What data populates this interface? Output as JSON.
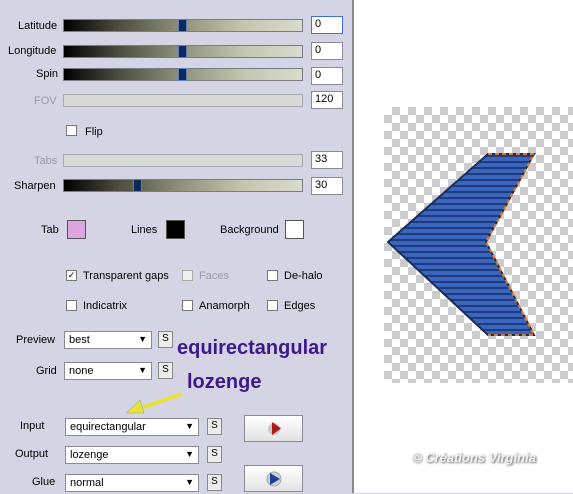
{
  "sliders": [
    {
      "label": "Latitude",
      "value": "0",
      "level": 0.5,
      "enabled": true,
      "focused": true
    },
    {
      "label": "Longitude",
      "value": "0",
      "level": 0.5,
      "enabled": true
    },
    {
      "label": "Spin",
      "value": "0",
      "level": 0.5,
      "enabled": true
    },
    {
      "label": "FOV",
      "value": "120",
      "enabled": false
    },
    {
      "label": "Tabs",
      "value": "33",
      "enabled": false
    },
    {
      "label": "Sharpen",
      "value": "30",
      "level": 0.3,
      "enabled": true
    }
  ],
  "flip": {
    "label": "Flip",
    "checked": false
  },
  "colors": {
    "tab": {
      "label": "Tab",
      "color": "#d9a6e0"
    },
    "lines": {
      "label": "Lines",
      "color": "#000000"
    },
    "background": {
      "label": "Background",
      "color": "#ffffff"
    }
  },
  "checkboxes": {
    "transparent_gaps": {
      "label": "Transparent gaps",
      "checked": true
    },
    "faces": {
      "label": "Faces",
      "checked": false,
      "enabled": false
    },
    "de_halo": {
      "label": "De-halo",
      "checked": false
    },
    "indicatrix": {
      "label": "Indicatrix",
      "checked": false
    },
    "anamorph": {
      "label": "Anamorph",
      "checked": false
    },
    "edges": {
      "label": "Edges",
      "checked": false
    }
  },
  "selects": {
    "preview": {
      "label": "Preview",
      "value": "best"
    },
    "grid": {
      "label": "Grid",
      "value": "none"
    },
    "input": {
      "label": "Input",
      "value": "equirectangular"
    },
    "output": {
      "label": "Output",
      "value": "lozenge"
    },
    "glue": {
      "label": "Glue",
      "value": "normal"
    }
  },
  "s_button_label": "S",
  "annotations": {
    "line1": "equirectangular",
    "line2": "lozenge"
  },
  "watermark": "© Créations Virginia",
  "colors_ui": {
    "accent": "#3a1a8a",
    "shape_blue": "#3a66c0",
    "shape_orange": "#e07a2a"
  }
}
